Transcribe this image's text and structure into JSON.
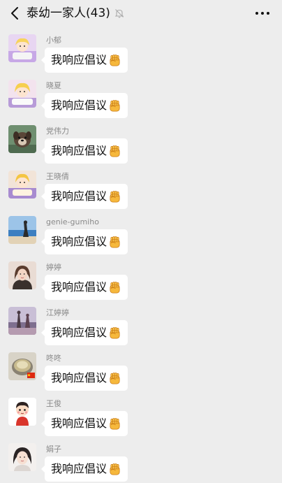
{
  "header": {
    "title": "泰幼一家人(43)",
    "back_icon": "back-chevron-icon",
    "mute_icon": "mute-bell-icon",
    "more_icon": "more-dots-icon"
  },
  "messages": [
    {
      "sender": "小郁",
      "text": "我响应倡议",
      "emoji": "raised-fist-emoji",
      "avatar": "cartoon-girl-avatar"
    },
    {
      "sender": "晓夏",
      "text": "我响应倡议",
      "emoji": "raised-fist-emoji",
      "avatar": "cartoon-girl-avatar"
    },
    {
      "sender": "党伟力",
      "text": "我响应倡议",
      "emoji": "raised-fist-emoji",
      "avatar": "dog-photo-avatar"
    },
    {
      "sender": "王晓倩",
      "text": "我响应倡议",
      "emoji": "raised-fist-emoji",
      "avatar": "cartoon-girl-avatar"
    },
    {
      "sender": "genie-gumiho",
      "text": "我响应倡议",
      "emoji": "raised-fist-emoji",
      "avatar": "beach-photo-avatar"
    },
    {
      "sender": "婷婷",
      "text": "我响应倡议",
      "emoji": "raised-fist-emoji",
      "avatar": "portrait-photo-avatar"
    },
    {
      "sender": "江婷婷",
      "text": "我响应倡议",
      "emoji": "raised-fist-emoji",
      "avatar": "scenery-photo-avatar"
    },
    {
      "sender": "咚咚",
      "text": "我响应倡议",
      "emoji": "raised-fist-emoji",
      "avatar": "bowl-photo-avatar"
    },
    {
      "sender": "王俊",
      "text": "我响应倡议",
      "emoji": "raised-fist-emoji",
      "avatar": "cartoon-kid-avatar"
    },
    {
      "sender": "娟子",
      "text": "我响应倡议",
      "emoji": "raised-fist-emoji",
      "avatar": "portrait-photo-avatar"
    }
  ]
}
